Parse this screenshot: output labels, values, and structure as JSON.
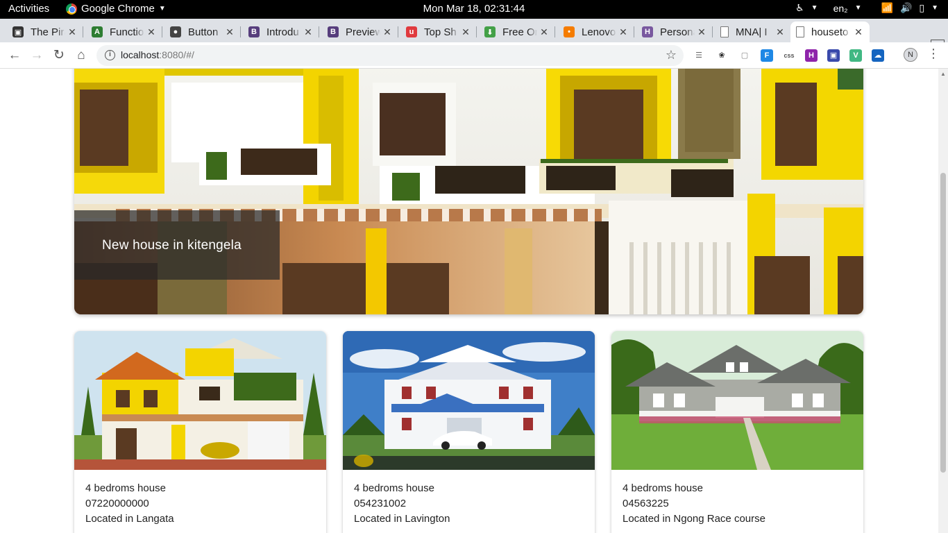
{
  "system": {
    "activities": "Activities",
    "app_name": "Google Chrome",
    "clock": "Mon Mar 18, 02:31:44",
    "keyboard": "en₂"
  },
  "tabs": [
    {
      "title": "The Pira",
      "icon": "terminal-icon",
      "color": "#333333",
      "glyph": "▣"
    },
    {
      "title": "Functio",
      "icon": "android-icon",
      "color": "#2e7d32",
      "glyph": "A"
    },
    {
      "title": "Button",
      "icon": "github-icon",
      "color": "#444444",
      "glyph": "●"
    },
    {
      "title": "Introdu",
      "icon": "bootstrap-icon",
      "color": "#563d7c",
      "glyph": "B"
    },
    {
      "title": "Preview",
      "icon": "bootstrap-icon",
      "color": "#563d7c",
      "glyph": "B"
    },
    {
      "title": "Top Sh",
      "icon": "udemy-icon",
      "color": "#e03a3e",
      "glyph": "u"
    },
    {
      "title": "Free Or",
      "icon": "download-icon",
      "color": "#43a047",
      "glyph": "⬇"
    },
    {
      "title": "Lenovo",
      "icon": "pin-icon",
      "color": "#f57c00",
      "glyph": "•"
    },
    {
      "title": "Persona",
      "icon": "heroku-icon",
      "color": "#79589f",
      "glyph": "H"
    },
    {
      "title": "MNA| I",
      "icon": "page-icon",
      "color": "#bbbbbb",
      "glyph": ""
    },
    {
      "title": "houseto",
      "icon": "page-icon",
      "color": "#bbbbbb",
      "glyph": ""
    }
  ],
  "browser": {
    "url_host": "localhost",
    "url_rest": ":8080/#/",
    "profile_initial": "N"
  },
  "extensions": [
    {
      "name": "reading-list-icon",
      "glyph": "☰",
      "color": "#666666"
    },
    {
      "name": "squirrel-icon",
      "glyph": "❀",
      "color": "#222222"
    },
    {
      "name": "search-box-icon",
      "glyph": "▢",
      "color": "#888888"
    },
    {
      "name": "fi-icon",
      "glyph": "F",
      "color": "#1e88e5"
    },
    {
      "name": "css-icon",
      "glyph": "css",
      "color": "#555555"
    },
    {
      "name": "hurl-icon",
      "glyph": "H",
      "color": "#8e24aa"
    },
    {
      "name": "flag-icon",
      "glyph": "▣",
      "color": "#3949ab"
    },
    {
      "name": "vue-icon",
      "glyph": "V",
      "color": "#41b883"
    },
    {
      "name": "cloud-icon",
      "glyph": "☁",
      "color": "#1565c0"
    }
  ],
  "hero": {
    "caption": "New house in kitengela"
  },
  "listings": [
    {
      "title": "4 bedroms house",
      "phone": "07220000000",
      "location": "Located in Langata"
    },
    {
      "title": "4 bedroms house",
      "phone": "054231002",
      "location": "Located in Lavington"
    },
    {
      "title": "4 bedroms house",
      "phone": "04563225",
      "location": "Located in Ngong Race course"
    }
  ]
}
